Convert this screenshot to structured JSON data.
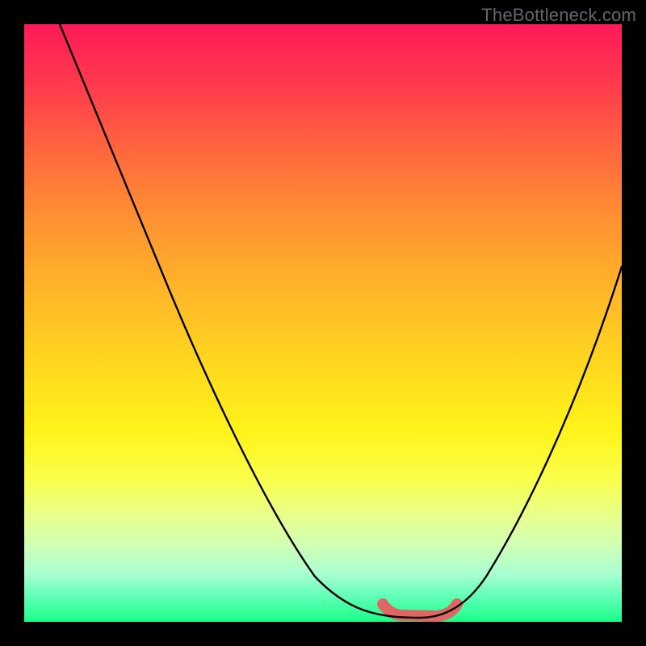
{
  "watermark": "TheBottleneck.com",
  "chart_data": {
    "type": "line",
    "title": "",
    "xlabel": "",
    "ylabel": "",
    "xlim": [
      0,
      100
    ],
    "ylim": [
      0,
      100
    ],
    "series": [
      {
        "name": "bottleneck-curve",
        "x": [
          6,
          10,
          15,
          20,
          25,
          30,
          35,
          40,
          45,
          50,
          53,
          55,
          58,
          60,
          63,
          65,
          68,
          70,
          73,
          78,
          82,
          86,
          90,
          95,
          100
        ],
        "y": [
          100,
          93,
          84,
          76,
          67,
          59,
          50,
          41,
          32,
          22,
          14,
          8,
          3,
          1,
          0,
          0,
          0,
          1,
          4,
          12,
          21,
          30,
          39,
          49,
          59
        ]
      },
      {
        "name": "optimal-range",
        "x": [
          60,
          62,
          64,
          66,
          68,
          70,
          72
        ],
        "y": [
          3,
          1,
          0,
          0,
          0,
          1,
          3
        ]
      }
    ]
  }
}
